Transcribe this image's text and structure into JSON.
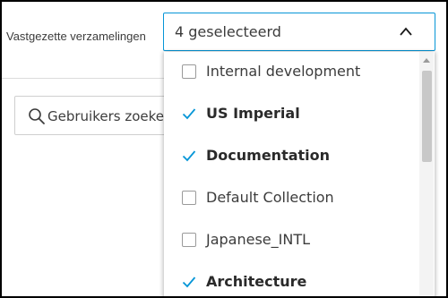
{
  "filter": {
    "label": "Vastgezette verzamelingen",
    "selected_value": "4 geselecteerd"
  },
  "search": {
    "placeholder": "Gebruikers zoeken",
    "icon": "search-icon"
  },
  "collections": [
    {
      "label": "Internal development",
      "checked": false
    },
    {
      "label": "US Imperial",
      "checked": true
    },
    {
      "label": "Documentation",
      "checked": true
    },
    {
      "label": "Default Collection",
      "checked": false
    },
    {
      "label": "Japanese_INTL",
      "checked": false
    },
    {
      "label": "Architecture",
      "checked": true
    }
  ],
  "colors": {
    "accent": "#0696d7",
    "text": "#3c3c3c"
  }
}
